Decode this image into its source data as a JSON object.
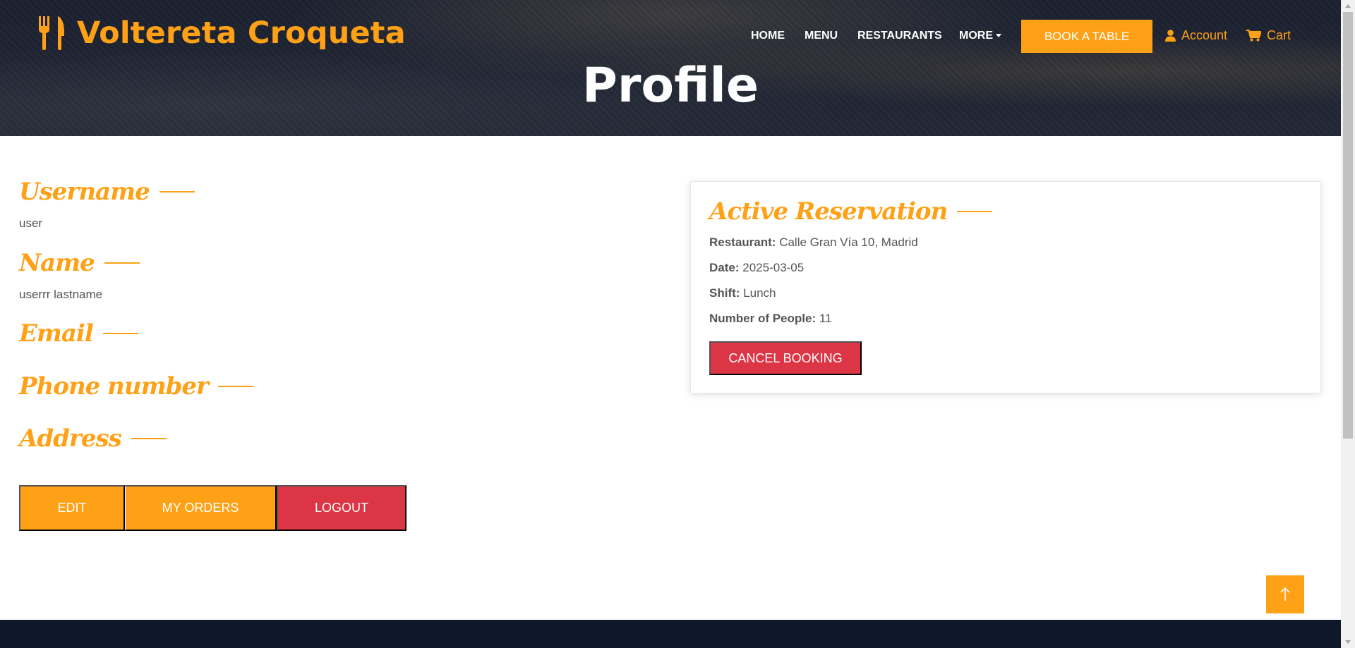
{
  "header": {
    "brand": "Voltereta Croqueta",
    "nav": {
      "home": "HOME",
      "menu": "MENU",
      "restaurants": "RESTAURANTS",
      "more": "MORE"
    },
    "book_table": "BOOK A TABLE",
    "account": "Account",
    "cart": "Cart",
    "page_title": "Profile"
  },
  "profile": {
    "username_label": "Username",
    "username_value": "user",
    "name_label": "Name",
    "name_value": "userrr lastname",
    "email_label": "Email",
    "phone_label": "Phone number",
    "address_label": "Address",
    "buttons": {
      "edit": "EDIT",
      "my_orders": "MY ORDERS",
      "logout": "LOGOUT"
    }
  },
  "reservation": {
    "title": "Active Reservation",
    "restaurant_label": "Restaurant:",
    "restaurant_value": "Calle Gran Vía 10, Madrid",
    "date_label": "Date:",
    "date_value": "2025-03-05",
    "shift_label": "Shift:",
    "shift_value": "Lunch",
    "people_label": "Number of People:",
    "people_value": "11",
    "cancel": "CANCEL BOOKING"
  },
  "colors": {
    "accent": "#fea116",
    "danger": "#dc3545",
    "dark": "#0f172b"
  },
  "icons": {
    "brand": "utensils-icon",
    "account": "user-icon",
    "cart": "cart-icon",
    "to_top": "arrow-up-icon"
  }
}
